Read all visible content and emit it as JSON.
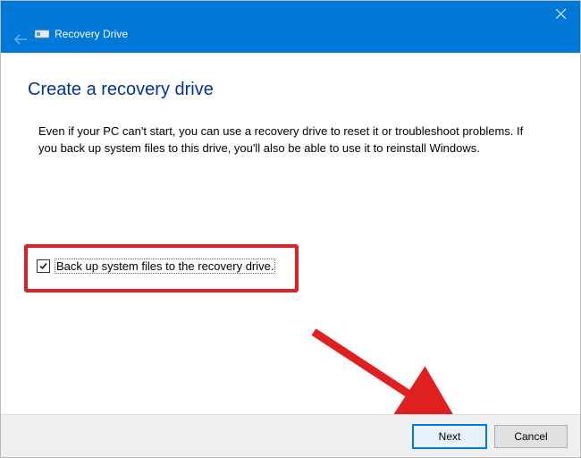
{
  "window": {
    "title": "Recovery Drive"
  },
  "page": {
    "heading": "Create a recovery drive",
    "description": "Even if your PC can't start, you can use a recovery drive to reset it or troubleshoot problems. If you back up system files to this drive, you'll also be able to use it to reinstall Windows."
  },
  "checkbox": {
    "label": "Back up system files to the recovery drive.",
    "checked": true
  },
  "buttons": {
    "next": "Next",
    "cancel": "Cancel"
  }
}
